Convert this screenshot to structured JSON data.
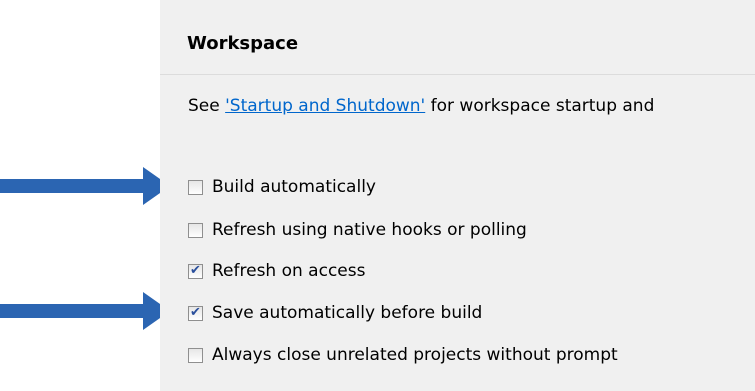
{
  "section": {
    "title": "Workspace"
  },
  "intro": {
    "prefix": "See ",
    "link_text": "'Startup and Shutdown'",
    "suffix": " for workspace startup and"
  },
  "options": [
    {
      "label": "Build automatically",
      "checked": false
    },
    {
      "label": "Refresh using native hooks or polling",
      "checked": false
    },
    {
      "label": "Refresh on access",
      "checked": true
    },
    {
      "label": "Save automatically before build",
      "checked": true
    },
    {
      "label": "Always close unrelated projects without prompt",
      "checked": false
    }
  ],
  "colors": {
    "arrow": "#2b65b2",
    "link": "#0066cc",
    "panel_bg": "#f0f0f0"
  },
  "icons": {
    "check": "check-icon",
    "arrow": "arrow-right-icon"
  }
}
